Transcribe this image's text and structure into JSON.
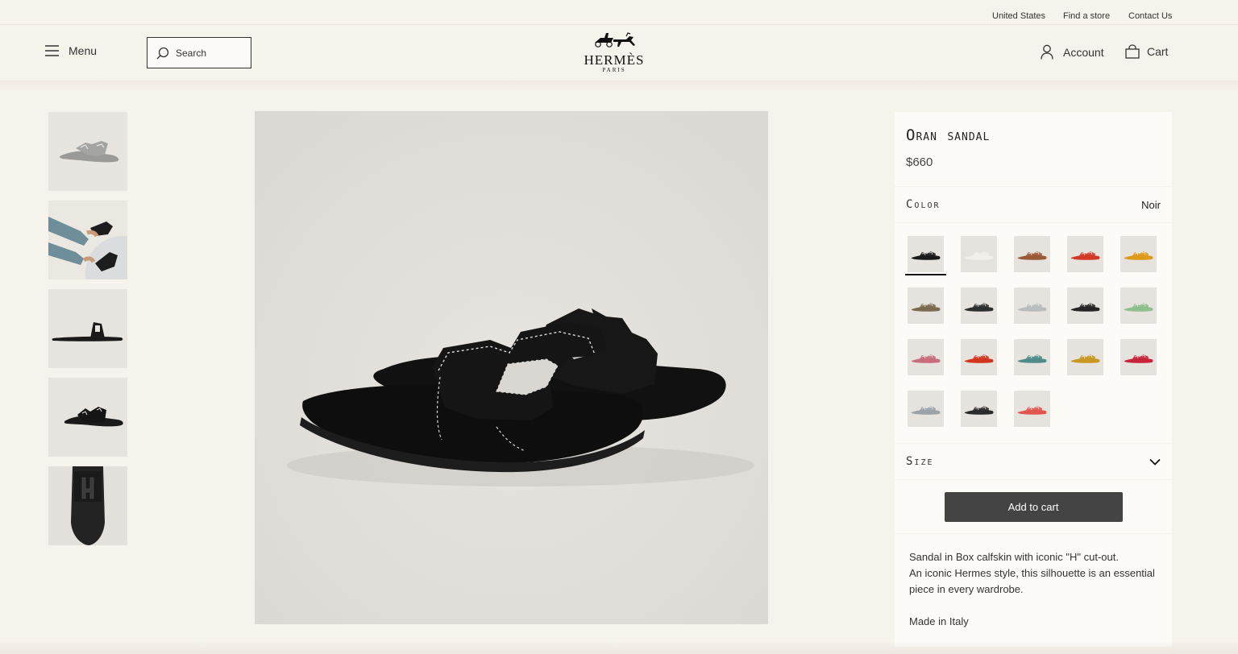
{
  "topbar": {
    "country": "United States",
    "find_store": "Find a store",
    "contact": "Contact Us"
  },
  "header": {
    "menu_label": "Menu",
    "search_placeholder": "Search",
    "logo_word": "HERMÈS",
    "logo_sub": "PARIS",
    "account_label": "Account",
    "cart_label": "Cart",
    "icons": [
      "menu-icon",
      "search-icon",
      "hermes-logo",
      "account-icon",
      "cart-icon"
    ]
  },
  "gallery": {
    "thumbnails": [
      {
        "name": "thumb-pair-gray",
        "active": true
      },
      {
        "name": "thumb-worn"
      },
      {
        "name": "thumb-side"
      },
      {
        "name": "thumb-pair-black"
      },
      {
        "name": "thumb-top"
      }
    ]
  },
  "product": {
    "title": "Oran sandal",
    "price": "$660",
    "color_label": "Color",
    "color_value": "Noir",
    "size_label": "Size",
    "add_to_cart": "Add to cart",
    "description_lines": [
      "Sandal in Box calfskin with iconic \"H\" cut-out.",
      "An iconic Hermes style, this silhouette is an essential piece in every wardrobe."
    ],
    "origin": "Made in Italy",
    "swatch_colors": [
      "#1b1b1b",
      "#f2f0ec",
      "#9a5a36",
      "#d33a26",
      "#dd9a1a",
      "#7b6a50",
      "#2d3030",
      "#b8bcbe",
      "#272525",
      "#8fbf8c",
      "#c86d7a",
      "#d2361f",
      "#4f8c8a",
      "#c99722",
      "#c7233a",
      "#9aa3a8",
      "#2b2b2b",
      "#e0564f"
    ],
    "selected_swatch": 0
  },
  "colors": {
    "background": "#f6f2ec",
    "panel": "#fcfbf8",
    "button": "#444444",
    "sandal": "#151515"
  }
}
